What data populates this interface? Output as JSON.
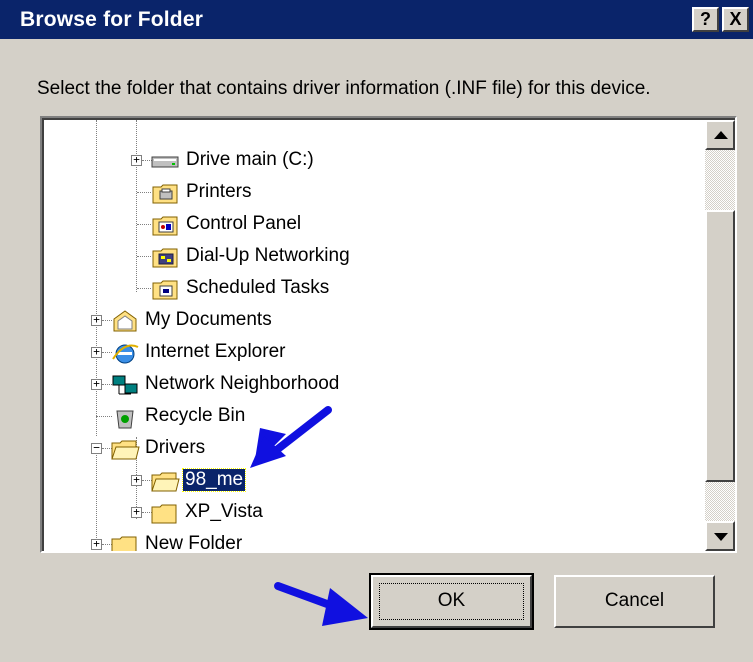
{
  "window": {
    "title": "Browse for Folder",
    "help_label": "?",
    "close_label": "X"
  },
  "instructions": "Select the folder that contains driver information (.INF file) for this device.",
  "tree": {
    "items": [
      {
        "label": "Drive main (C:)",
        "icon": "hard-drive-icon",
        "expander": "+"
      },
      {
        "label": "Printers",
        "icon": "printers-folder-icon",
        "expander": ""
      },
      {
        "label": "Control Panel",
        "icon": "control-panel-folder-icon",
        "expander": ""
      },
      {
        "label": "Dial-Up Networking",
        "icon": "dial-up-folder-icon",
        "expander": ""
      },
      {
        "label": "Scheduled Tasks",
        "icon": "scheduled-tasks-folder-icon",
        "expander": ""
      },
      {
        "label": "My Documents",
        "icon": "my-documents-icon",
        "expander": "+"
      },
      {
        "label": "Internet Explorer",
        "icon": "internet-explorer-icon",
        "expander": "+"
      },
      {
        "label": "Network Neighborhood",
        "icon": "network-neighborhood-icon",
        "expander": "+"
      },
      {
        "label": "Recycle Bin",
        "icon": "recycle-bin-icon",
        "expander": ""
      },
      {
        "label": "Drivers",
        "icon": "folder-open-icon",
        "expander": "−"
      },
      {
        "label": "98_me",
        "icon": "folder-open-icon",
        "expander": "+",
        "selected": true
      },
      {
        "label": "XP_Vista",
        "icon": "folder-icon",
        "expander": "+"
      },
      {
        "label": "New Folder",
        "icon": "folder-icon",
        "expander": "+"
      }
    ]
  },
  "buttons": {
    "ok": "OK",
    "cancel": "Cancel"
  },
  "annotations": {
    "arrow_color": "#1010e0"
  },
  "colors": {
    "titlebar": "#0a246a",
    "selection": "#0a246a",
    "face": "#d4d0c8"
  }
}
